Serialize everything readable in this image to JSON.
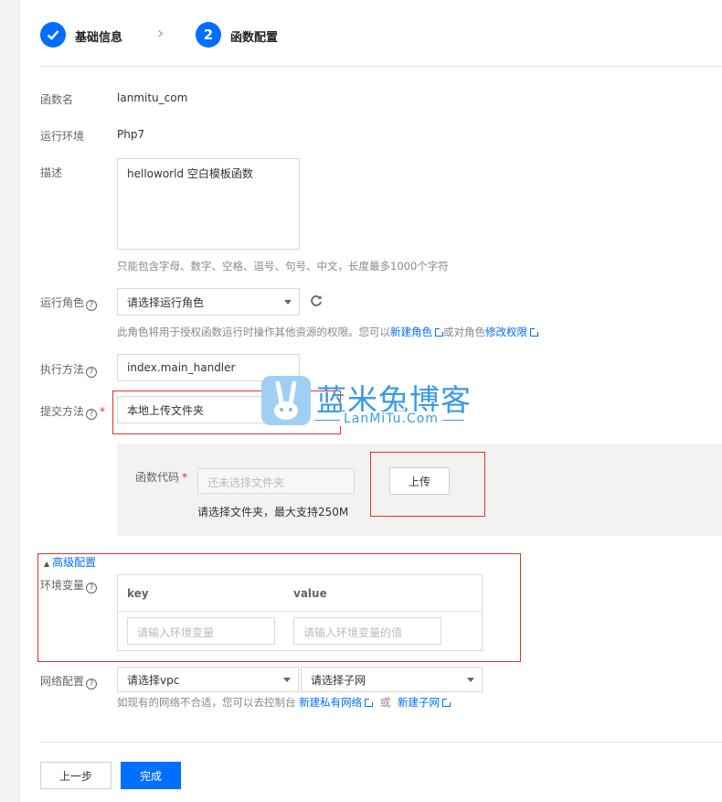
{
  "steps": [
    {
      "label": "基础信息",
      "state": "done"
    },
    {
      "label": "函数配置",
      "number": "2",
      "state": "active"
    }
  ],
  "form": {
    "name_label": "函数名",
    "name_value": "lanmitu_com",
    "runtime_label": "运行环境",
    "runtime_value": "Php7",
    "desc_label": "描述",
    "desc_value": "helloworld 空白模板函数",
    "desc_hint": "只能包含字母、数字、空格、逗号、句号、中文，长度最多1000个字符",
    "role_label": "运行角色",
    "role_selected": "请选择运行角色",
    "role_hint_prefix": "此角色将用于授权函数运行时操作其他资源的权限。您可以",
    "role_link_new": "新建角色",
    "role_hint_mid": "或对角色",
    "role_link_modify": "修改权限",
    "handler_label": "执行方法",
    "handler_value": "index.main_handler",
    "submit_label": "提交方法",
    "submit_selected": "本地上传文件夹",
    "code_label": "函数代码",
    "code_placeholder": "还未选择文件夹",
    "upload_button": "上传",
    "code_hint": "请选择文件夹，最大支持250M",
    "advanced_toggle": "高级配置",
    "env_label": "环境变量",
    "env_col_key": "key",
    "env_col_value": "value",
    "env_key_placeholder": "请输入环境变量",
    "env_value_placeholder": "请输入环境变量的值",
    "network_label": "网络配置",
    "vpc_selected": "请选择vpc",
    "subnet_selected": "请选择子网",
    "network_hint_prefix": "如现有的网络不合适，您可以去控制台",
    "network_link_vpc": "新建私有网络",
    "network_hint_or": "或",
    "network_link_subnet": "新建子网"
  },
  "buttons": {
    "prev": "上一步",
    "finish": "完成"
  },
  "watermark": {
    "title": "蓝米兔博客",
    "subtitle": "LanMiTu.Com"
  },
  "colors": {
    "accent": "#006eff",
    "highlight": "#e0322b"
  }
}
